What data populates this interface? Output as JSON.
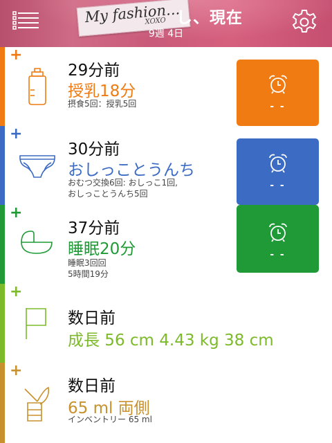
{
  "header": {
    "title": "し、現在",
    "subtitle": "9週 4日",
    "sticker": {
      "main": "My fashion...",
      "sub": "XOXO"
    },
    "icons": {
      "menu": "list-menu-icon",
      "settings": "gear-icon"
    }
  },
  "rows": [
    {
      "category": "feeding",
      "color": "#f07b12",
      "plus": "+",
      "time": "29分前",
      "value": "授乳18分",
      "detail": [
        "摂食5回：授乳5回"
      ],
      "icon": "baby-bottle-icon",
      "alarm": {
        "label": "- -",
        "color": "#f07b12",
        "icon": "alarm-clock-icon"
      }
    },
    {
      "category": "diaper",
      "color": "#3c6bc4",
      "plus": "+",
      "time": "30分前",
      "value": "おしっことうんち",
      "detail": [
        "おむつ交換6回: おしっこ1回,",
        "おしっことうんち5回"
      ],
      "icon": "diaper-icon",
      "alarm": {
        "label": "- -",
        "color": "#3c6bc4",
        "icon": "alarm-clock-icon"
      }
    },
    {
      "category": "sleep",
      "color": "#1f9a37",
      "plus": "+",
      "time": "37分前",
      "value": "睡眠20分",
      "detail": [
        "睡眠3回回",
        "5時間19分"
      ],
      "icon": "crib-icon",
      "alarm": {
        "label": "- -",
        "color": "#1f9a37",
        "icon": "alarm-clock-icon"
      }
    },
    {
      "category": "growth",
      "color": "#7cba2a",
      "plus": "+",
      "time": "数日前",
      "value": "成長 56 cm 4.43 kg 38 cm",
      "detail": [],
      "icon": "flag-icon"
    },
    {
      "category": "pumping",
      "color": "#c8912e",
      "plus": "+",
      "time": "数日前",
      "value": "65 ml  両側",
      "detail": [
        "インベントリー 65 ml"
      ],
      "icon": "breast-pump-icon"
    }
  ]
}
